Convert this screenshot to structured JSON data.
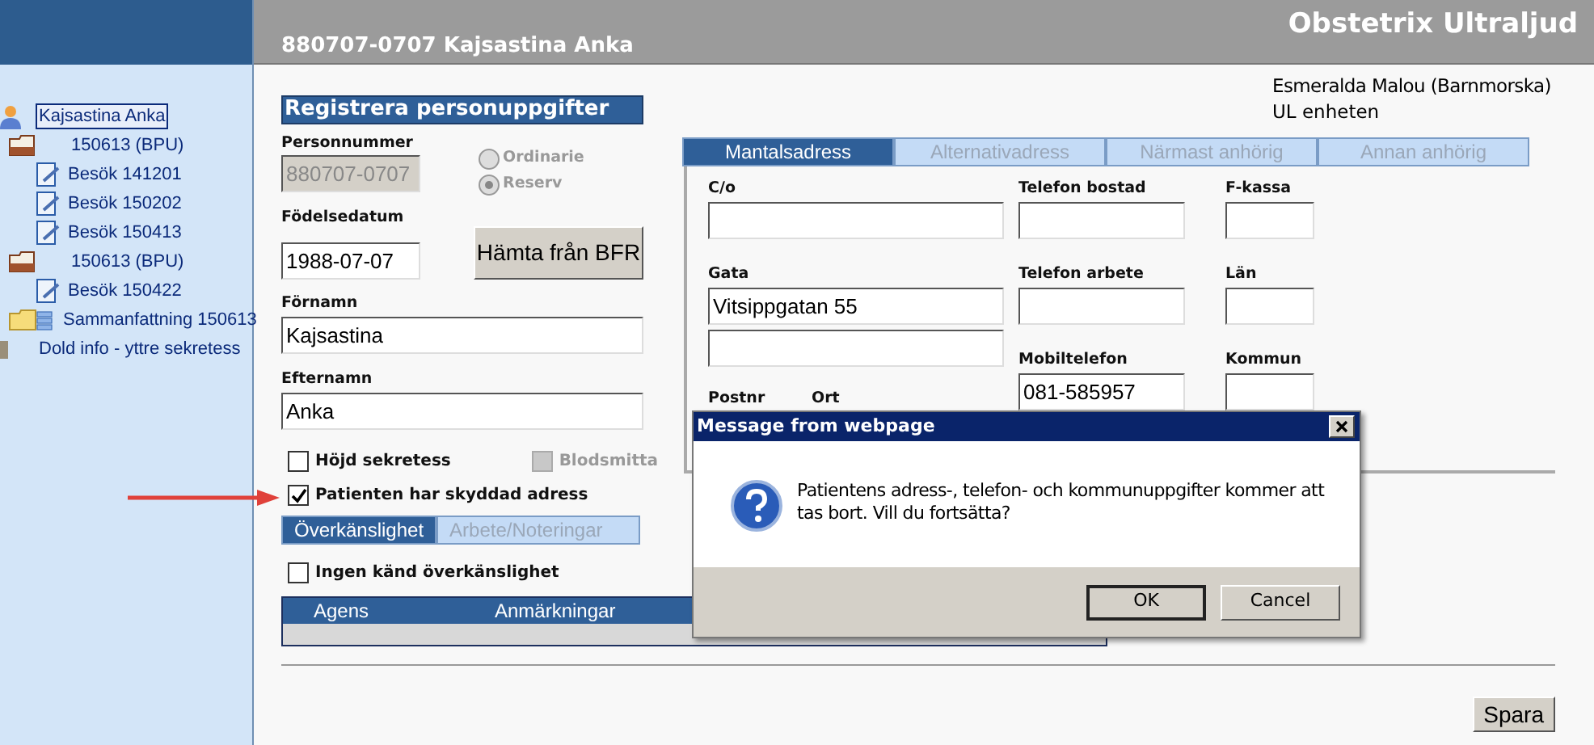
{
  "sidebar": {
    "tree": [
      {
        "kind": "person",
        "label": "Kajsastina Anka",
        "selected": true
      },
      {
        "kind": "folder",
        "label": "150613 (BPU)",
        "selected": false,
        "children": [
          {
            "kind": "visit",
            "label": "Besök 141201",
            "selected": false
          },
          {
            "kind": "visit",
            "label": "Besök 150202",
            "selected": false
          },
          {
            "kind": "visit",
            "label": "Besök 150413",
            "selected": false
          }
        ]
      },
      {
        "kind": "folder",
        "label": "150613 (BPU)",
        "selected": false,
        "children": [
          {
            "kind": "visit",
            "label": "Besök 150422",
            "selected": false
          }
        ]
      },
      {
        "kind": "summary",
        "label": "Sammanfattning 150613",
        "selected": false
      },
      {
        "kind": "info",
        "label": "Dold info - yttre sekretess",
        "selected": false
      }
    ]
  },
  "header": {
    "patient_title": "880707-0707 Kajsastina Anka",
    "app_title": "Obstetrix Ultraljud"
  },
  "user": {
    "name": "Esmeralda Malou (Barnmorska)",
    "unit": "UL enheten"
  },
  "personal": {
    "title": "Registrera personuppgifter",
    "personnummer": {
      "label": "Personnummer",
      "value": "880707-0707",
      "disabled": true
    },
    "id_type": [
      {
        "label": "Ordinarie",
        "selected": false
      },
      {
        "label": "Reserv",
        "selected": true
      }
    ],
    "birthdate": {
      "label": "Födelsedatum",
      "value": "1988-07-07"
    },
    "fetch_button": "Hämta från BFR",
    "first_name": {
      "label": "Förnamn",
      "value": "Kajsastina"
    },
    "last_name": {
      "label": "Efternamn",
      "value": "Anka"
    },
    "flags": [
      {
        "label": "Höjd sekretess",
        "checked": false,
        "disabled": false
      },
      {
        "label": "Blodsmitta",
        "checked": false,
        "disabled": true
      },
      {
        "label": "Patienten har skyddad adress",
        "checked": true,
        "disabled": false
      }
    ]
  },
  "allergy": {
    "tabs": [
      {
        "label": "Överkänslighet",
        "selected": true
      },
      {
        "label": "Arbete/Noteringar",
        "selected": false
      }
    ],
    "no_known": {
      "label": "Ingen känd överkänslighet",
      "checked": false
    },
    "table": {
      "columns": [
        "Agens",
        "Anmärkningar"
      ]
    }
  },
  "address": {
    "tabs": [
      {
        "label": "Mantalsadress",
        "selected": true
      },
      {
        "label": "Alternativadress",
        "selected": false
      },
      {
        "label": "Närmast anhörig",
        "selected": false
      },
      {
        "label": "Annan anhörig",
        "selected": false
      }
    ],
    "columns": [
      [
        {
          "kind": "field",
          "label": "C/o"
        },
        {
          "kind": "field",
          "label": "Gata",
          "value": "Vitsippgatan 55"
        },
        {
          "kind": "extra"
        },
        {
          "kind": "pair",
          "parts": [
            {
              "label": "Postnr"
            },
            {
              "label": "Ort"
            }
          ]
        }
      ],
      [
        {
          "kind": "field",
          "label": "Telefon bostad"
        },
        {
          "kind": "field",
          "label": "Telefon arbete"
        },
        {
          "kind": "field",
          "label": "Mobiltelefon",
          "value": "081-585957"
        }
      ],
      [
        {
          "kind": "field",
          "label": "F-kassa"
        },
        {
          "kind": "field",
          "label": "Län"
        },
        {
          "kind": "field",
          "label": "Kommun"
        }
      ]
    ]
  },
  "save_button": "Spara",
  "dialog": {
    "title": "Message from webpage",
    "message": "Patientens adress-, telefon- och kommunuppgifter kommer att tas bort. Vill du fortsätta?",
    "buttons": [
      {
        "label": "OK",
        "default": true
      },
      {
        "label": "Cancel",
        "default": false
      }
    ]
  }
}
